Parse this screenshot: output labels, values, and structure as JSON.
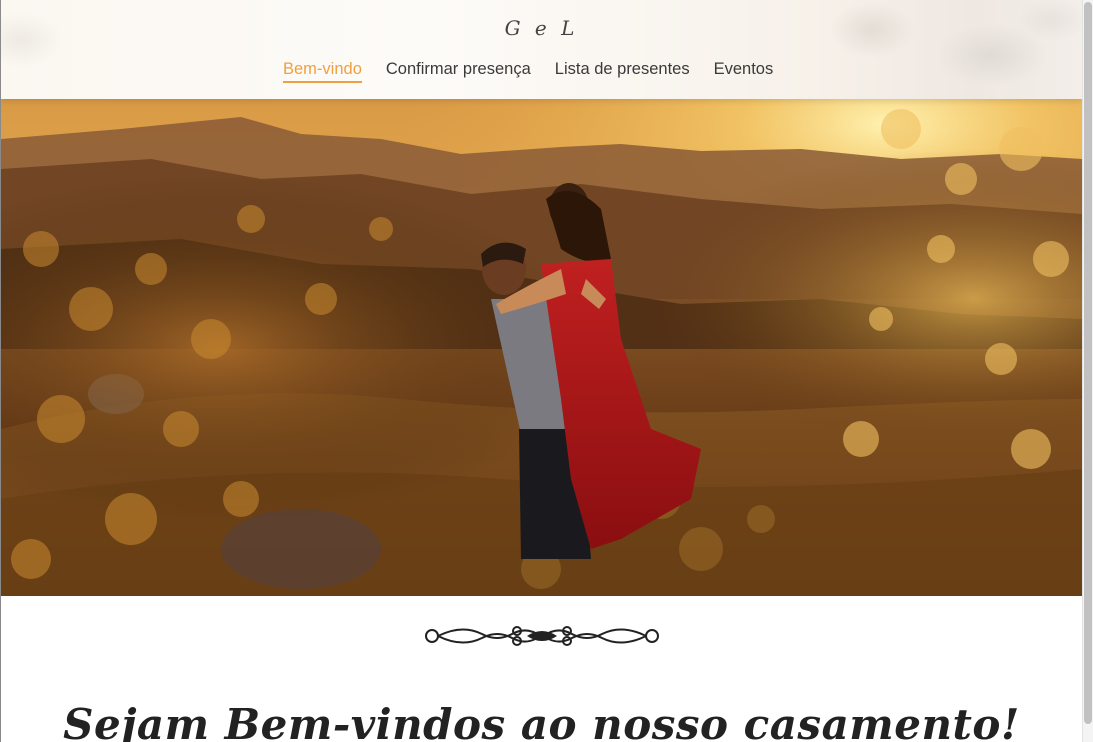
{
  "header": {
    "logo": "G e L",
    "nav": [
      {
        "label": "Bem-vindo",
        "active": true
      },
      {
        "label": "Confirmar presença",
        "active": false
      },
      {
        "label": "Lista de presentes",
        "active": false
      },
      {
        "label": "Eventos",
        "active": false
      }
    ]
  },
  "hero": {
    "icon": "couple-sunset-photo"
  },
  "main": {
    "ornament_icon": "scroll-flourish-icon",
    "welcome_text": "Sejam Bem-vindos ao nosso casamento!"
  },
  "colors": {
    "accent": "#f0a040",
    "text": "#3a3a3a",
    "heading": "#222222"
  }
}
